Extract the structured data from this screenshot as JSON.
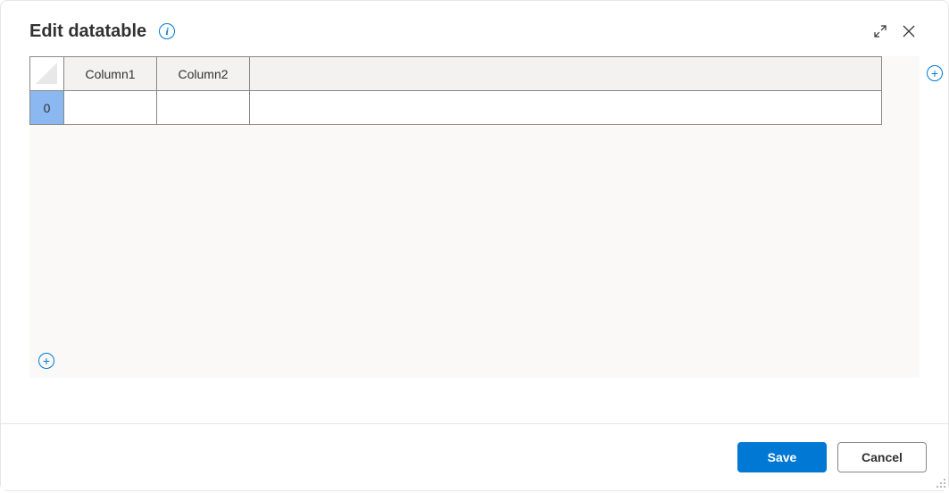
{
  "dialog": {
    "title": "Edit datatable"
  },
  "table": {
    "columns": [
      "Column1",
      "Column2"
    ],
    "rows": [
      {
        "index": "0",
        "cells": [
          "",
          ""
        ]
      }
    ]
  },
  "buttons": {
    "save": "Save",
    "cancel": "Cancel"
  }
}
